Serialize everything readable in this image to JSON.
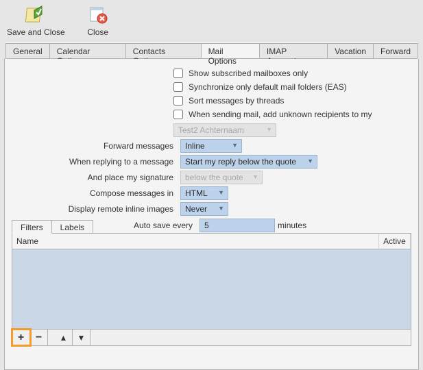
{
  "toolbar": {
    "save_close": "Save and Close",
    "close": "Close"
  },
  "tabs": [
    "General",
    "Calendar Options",
    "Contacts Options",
    "Mail Options",
    "IMAP Accounts",
    "Vacation",
    "Forward"
  ],
  "active_tab": 3,
  "checks": {
    "subscribed": "Show subscribed mailboxes only",
    "sync_default": "Synchronize only default mail folders (EAS)",
    "sort_threads": "Sort messages by threads",
    "add_unknown": "When sending mail, add unknown recipients to my"
  },
  "address_book_select": "Test2 Achternaam",
  "fields": {
    "forward_messages": {
      "label": "Forward messages",
      "value": "Inline"
    },
    "reply": {
      "label": "When replying to a message",
      "value": "Start my reply below the quote"
    },
    "signature_place": {
      "label": "And place my signature",
      "value": "below the quote"
    },
    "compose": {
      "label": "Compose messages in",
      "value": "HTML"
    },
    "remote_images": {
      "label": "Display remote inline images",
      "value": "Never"
    },
    "autosave": {
      "label": "Auto save every",
      "value": "5",
      "unit": "minutes"
    }
  },
  "subtabs": [
    "Filters",
    "Labels"
  ],
  "active_subtab": 0,
  "table": {
    "col_name": "Name",
    "col_active": "Active"
  }
}
